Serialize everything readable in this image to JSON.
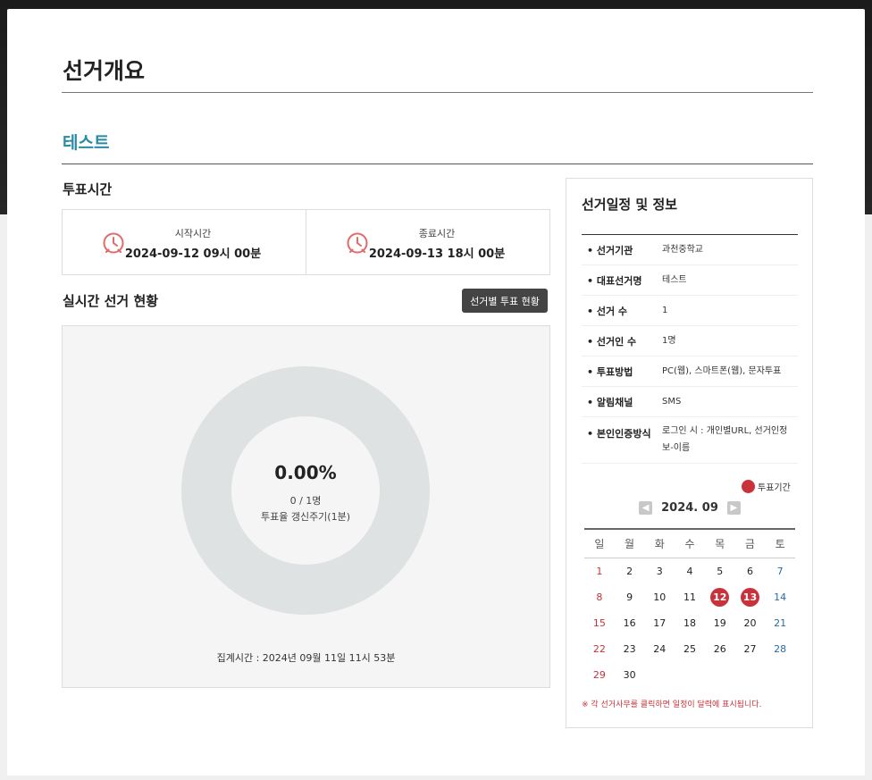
{
  "page_title": "선거개요",
  "election_name": "테스트",
  "vote_time": {
    "heading": "투표시간",
    "start": {
      "label": "시작시간",
      "value": "2024-09-12 09시 00분"
    },
    "end": {
      "label": "종료시간",
      "value": "2024-09-13 18시 00분"
    }
  },
  "realtime": {
    "heading": "실시간 선거 현황",
    "button_label": "선거별 투표 현황",
    "turnout_pct": "0.00%",
    "turnout_fraction": 0.0,
    "count": "0 / 1명",
    "refresh_cycle": "투표율 갱신주기(1분)",
    "aggregated_time": "집계시간 : 2024년 09월 11일 11시 53분"
  },
  "side": {
    "title": "선거일정 및 정보",
    "rows": [
      {
        "key": "• 선거기관",
        "value": "과천중학교"
      },
      {
        "key": "• 대표선거명",
        "value": "테스트"
      },
      {
        "key": "• 선거 수",
        "value": "1"
      },
      {
        "key": "• 선거인 수",
        "value": "1명"
      },
      {
        "key": "• 투표방법",
        "value": "PC(웹), 스마트폰(웹), 문자투표"
      },
      {
        "key": "• 알림채널",
        "value": "SMS"
      },
      {
        "key": "• 본인인증방식",
        "value": "로그인 시 : 개인별URL, 선거인정보-이름"
      }
    ],
    "legend_label": "투표기간",
    "calendar": {
      "month_label": "2024. 09",
      "prev_icon": "chevron-left-icon",
      "next_icon": "chevron-right-icon",
      "weekdays": [
        "일",
        "월",
        "화",
        "수",
        "목",
        "금",
        "토"
      ],
      "weeks": [
        [
          "1",
          "2",
          "3",
          "4",
          "5",
          "6",
          "7"
        ],
        [
          "8",
          "9",
          "10",
          "11",
          "12",
          "13",
          "14"
        ],
        [
          "15",
          "16",
          "17",
          "18",
          "19",
          "20",
          "21"
        ],
        [
          "22",
          "23",
          "24",
          "25",
          "26",
          "27",
          "28"
        ],
        [
          "29",
          "30",
          "",
          "",
          "",
          "",
          ""
        ]
      ],
      "marked_days": [
        "12",
        "13"
      ]
    },
    "note": "※ 각 선거사무를 클릭하면 일정이 달력에 표시됩니다."
  },
  "colors": {
    "accent": "#2a8aa6",
    "mark_red": "#c8323a",
    "button_dark": "#444444",
    "donut_gray": "#dfe2e2"
  }
}
